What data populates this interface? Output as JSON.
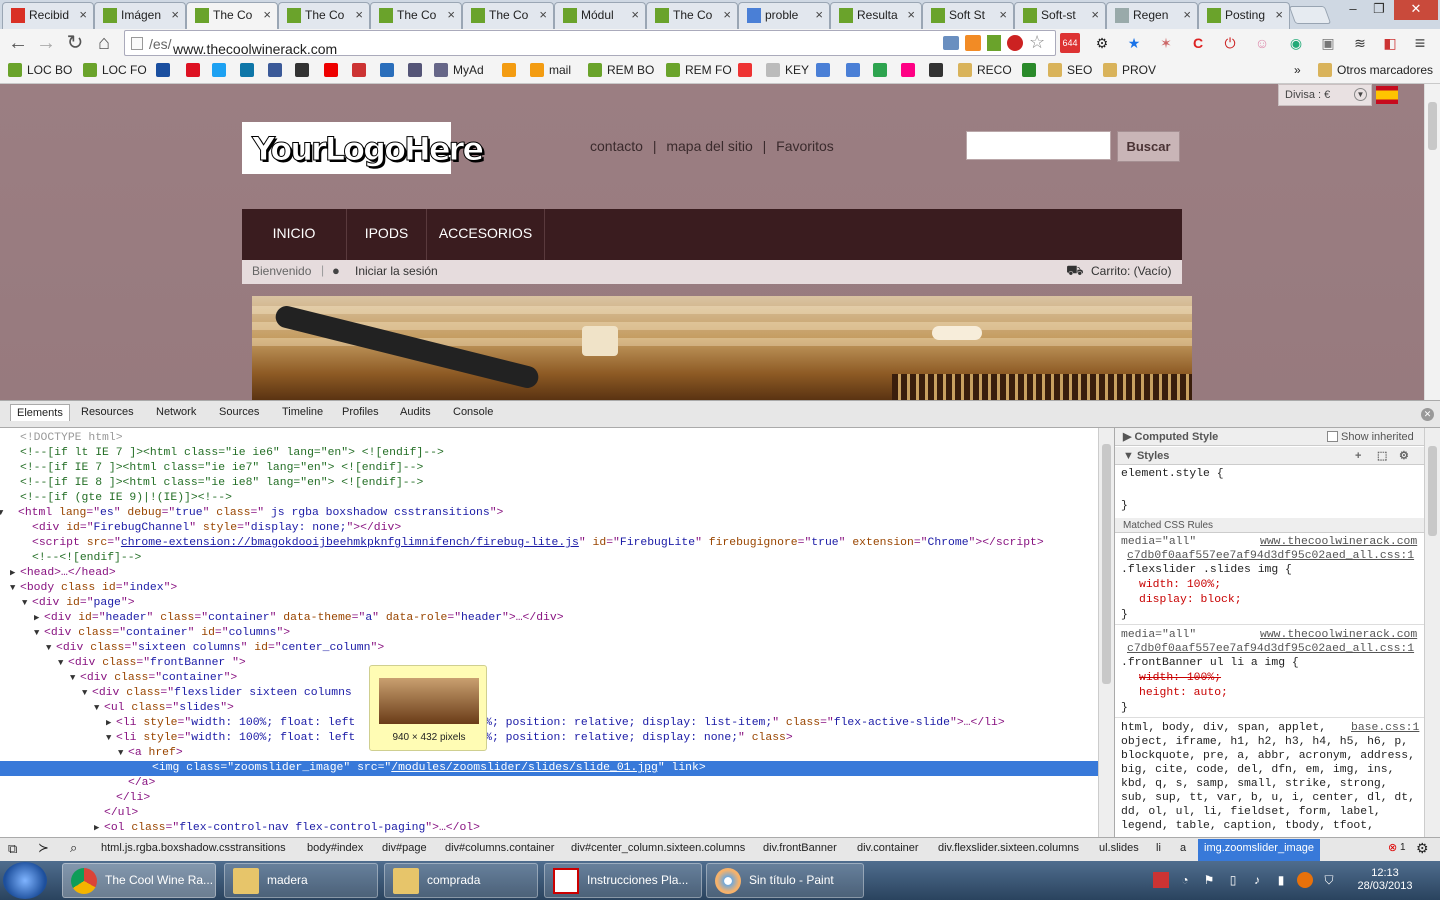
{
  "browser": {
    "tabs": [
      {
        "label": "Recibid",
        "icon": "gmail-icon",
        "color": "#d93025"
      },
      {
        "label": "Imágen",
        "icon": "prestashop-icon",
        "color": "#6aa32b"
      },
      {
        "label": "The Co",
        "icon": "prestashop-icon",
        "color": "#6aa32b"
      },
      {
        "label": "The Co",
        "icon": "prestashop-icon",
        "color": "#6aa32b"
      },
      {
        "label": "The Co",
        "icon": "prestashop-icon",
        "color": "#6aa32b"
      },
      {
        "label": "The Co",
        "icon": "prestashop-icon",
        "color": "#6aa32b"
      },
      {
        "label": "Módul",
        "icon": "prestashop-icon",
        "color": "#6aa32b"
      },
      {
        "label": "The Co",
        "icon": "prestashop-icon",
        "color": "#6aa32b"
      },
      {
        "label": "proble",
        "icon": "google-icon",
        "color": "#4a7fd6"
      },
      {
        "label": "Resulta",
        "icon": "prestashop-icon",
        "color": "#6aa32b"
      },
      {
        "label": "Soft St",
        "icon": "prestashop-icon",
        "color": "#6aa32b"
      },
      {
        "label": "Soft-st",
        "icon": "prestashop-icon",
        "color": "#6aa32b"
      },
      {
        "label": "Regen",
        "icon": "page-icon",
        "color": "#9aa"
      },
      {
        "label": "Posting",
        "icon": "prestashop-icon",
        "color": "#6aa32b"
      }
    ],
    "active_tab": 2,
    "close_glyph": "×",
    "window_controls": [
      "–",
      "❐",
      "✕"
    ],
    "url_host": "www.thecoolwinerack.com",
    "url_path": "/es/",
    "badge": "644",
    "bookmarks": [
      {
        "label": "LOC BO",
        "color": "#6aa32b"
      },
      {
        "label": "LOC FO",
        "color": "#6aa32b"
      },
      {
        "label": "",
        "color": "#1a4fa0"
      },
      {
        "label": "",
        "color": "#d12"
      },
      {
        "label": "",
        "color": "#1da1f2"
      },
      {
        "label": "",
        "color": "#0e76a8"
      },
      {
        "label": "",
        "color": "#3b5998"
      },
      {
        "label": "",
        "color": "#333"
      },
      {
        "label": "",
        "color": "#e00"
      },
      {
        "label": "",
        "color": "#c33"
      },
      {
        "label": "",
        "color": "#2a6ebb"
      },
      {
        "label": "",
        "color": "#557"
      },
      {
        "label": "MyAd",
        "color": "#668"
      },
      {
        "label": "",
        "color": "#f39c12"
      },
      {
        "label": "mail",
        "color": "#f39c12"
      },
      {
        "label": "REM BO",
        "color": "#6aa32b"
      },
      {
        "label": "REM FO",
        "color": "#6aa32b"
      },
      {
        "label": "",
        "color": "#e33"
      },
      {
        "label": "KEY",
        "color": "#bbb"
      },
      {
        "label": "",
        "color": "#4a7fd6"
      },
      {
        "label": "",
        "color": "#4a7fd6"
      },
      {
        "label": "",
        "color": "#2ea44f"
      },
      {
        "label": "",
        "color": "#ff0084"
      },
      {
        "label": "",
        "color": "#333"
      },
      {
        "label": "RECO",
        "color": "#d9b35b"
      },
      {
        "label": "",
        "color": "#2a8a2a"
      },
      {
        "label": "SEO",
        "color": "#d9b35b"
      },
      {
        "label": "PROV",
        "color": "#d9b35b"
      }
    ],
    "more_bookmarks": "»",
    "otros_marcadores": "Otros marcadores"
  },
  "site": {
    "divisa": "Divisa : €",
    "logo_text": "YourLogoHere",
    "toplinks": [
      "contacto",
      "mapa del sitio",
      "Favoritos"
    ],
    "separator": "|",
    "search_button": "Buscar",
    "menu": [
      "INICIO",
      "IPODS",
      "ACCESORIOS"
    ],
    "welcome": "Bienvenido",
    "login": "Iniciar la sesión",
    "cart": "Carrito: (Vacío)"
  },
  "devtools": {
    "tabs": [
      "Elements",
      "Resources",
      "Network",
      "Sources",
      "Timeline",
      "Profiles",
      "Audits",
      "Console"
    ],
    "dom_lines": [
      {
        "indent": 1,
        "tri": "",
        "html": "<span style='color:#999'>&lt;!DOCTYPE html&gt;</span>"
      },
      {
        "indent": 1,
        "tri": "",
        "html": "<span class='cm'>&lt;!--[if lt IE 7 ]&gt;&lt;html class=\"ie ie6\" lang=\"en\"&gt; &lt;![endif]--&gt;</span>"
      },
      {
        "indent": 1,
        "tri": "",
        "html": "<span class='cm'>&lt;!--[if IE 7 ]&gt;&lt;html class=\"ie ie7\" lang=\"en\"&gt; &lt;![endif]--&gt;</span>"
      },
      {
        "indent": 1,
        "tri": "",
        "html": "<span class='cm'>&lt;!--[if IE 8 ]&gt;&lt;html class=\"ie ie8\" lang=\"en\"&gt; &lt;![endif]--&gt;</span>"
      },
      {
        "indent": 1,
        "tri": "",
        "html": "<span class='cm'>&lt;!--[if (gte IE 9)|!(IE)]&gt;&lt;!--&gt;</span>"
      },
      {
        "indent": 0,
        "tri": "▼",
        "html": "&lt;html <span class='an'>lang</span>=\"<span class='av'>es</span>\" <span class='an'>debug</span>=\"<span class='av'>true</span>\" <span class='an'>class</span>=\"<span class='av'> js rgba boxshadow csstransitions</span>\"&gt;"
      },
      {
        "indent": 2,
        "tri": "",
        "html": "&lt;div <span class='an'>id</span>=\"<span class='av'>FirebugChannel</span>\" <span class='an'>style</span>=\"<span class='av'>display: none;</span>\"&gt;&lt;/div&gt;"
      },
      {
        "indent": 2,
        "tri": "",
        "html": "&lt;script <span class='an'>src</span>=\"<span class='lk'>chrome-extension://bmagokdooijbeehmkpknfglimnifench/firebug-lite.js</span>\" <span class='an'>id</span>=\"<span class='av'>FirebugLite</span>\" <span class='an'>firebugignore</span>=\"<span class='av'>true</span>\" <span class='an'>extension</span>=\"<span class='av'>Chrome</span>\"&gt;&lt;/script&gt;"
      },
      {
        "indent": 2,
        "tri": "",
        "html": "<span class='cm'>&lt;!--&lt;![endif]--&gt;</span>"
      },
      {
        "indent": 1,
        "tri": "▶",
        "html": "&lt;head&gt;…&lt;/head&gt;"
      },
      {
        "indent": 1,
        "tri": "▼",
        "html": "&lt;body <span class='an'>class</span> <span class='an'>id</span>=\"<span class='av'>index</span>\"&gt;"
      },
      {
        "indent": 2,
        "tri": "▼",
        "html": "&lt;div <span class='an'>id</span>=\"<span class='av'>page</span>\"&gt;"
      },
      {
        "indent": 3,
        "tri": "▶",
        "html": "&lt;div <span class='an'>id</span>=\"<span class='av'>header</span>\" <span class='an'>class</span>=\"<span class='av'>container</span>\" <span class='an'>data-theme</span>=\"<span class='av'>a</span>\" <span class='an'>data-role</span>=\"<span class='av'>header</span>\"&gt;…&lt;/div&gt;"
      },
      {
        "indent": 3,
        "tri": "▼",
        "html": "&lt;div <span class='an'>class</span>=\"<span class='av'>container</span>\" <span class='an'>id</span>=\"<span class='av'>columns</span>\"&gt;"
      },
      {
        "indent": 4,
        "tri": "▼",
        "html": "&lt;div <span class='an'>class</span>=\"<span class='av'>sixteen columns</span>\" <span class='an'>id</span>=\"<span class='av'>center_column</span>\"&gt;"
      },
      {
        "indent": 5,
        "tri": "▼",
        "html": "&lt;div <span class='an'>class</span>=\"<span class='av'>frontBanner </span>\"&gt;"
      },
      {
        "indent": 6,
        "tri": "▼",
        "html": "&lt;div <span class='an'>class</span>=\"<span class='av'>container</span>\"&gt;"
      },
      {
        "indent": 7,
        "tri": "▼",
        "html": "&lt;div <span class='an'>class</span>=\"<span class='av'>flexslider sixteen columns</span>"
      },
      {
        "indent": 8,
        "tri": "▼",
        "html": "&lt;ul <span class='an'>class</span>=\"<span class='av'>slides</span>\"&gt;"
      },
      {
        "indent": 9,
        "tri": "▶",
        "html": "&lt;li <span class='an'>style</span>=\"<span class='av'>width: 100%; float: left                100%; position: relative; display: list-item;</span>\" <span class='an'>class</span>=\"<span class='av'>flex-active-slide</span>\"&gt;…&lt;/li&gt;"
      },
      {
        "indent": 9,
        "tri": "▼",
        "html": "&lt;li <span class='an'>style</span>=\"<span class='av'>width: 100%; float: left                100%; position: relative; display: none;</span>\" <span class='an'>class</span>&gt;"
      },
      {
        "indent": 10,
        "tri": "▼",
        "html": "&lt;a <span class='an'>href</span>&gt;"
      },
      {
        "indent": 12,
        "tri": "",
        "html": "&lt;img class=\"zoomslider_image\" src=\"<u>/modules/zoomslider/slides/slide_01.jpg</u>\" link&gt;",
        "sel": true
      },
      {
        "indent": 10,
        "tri": "",
        "html": "&lt;/a&gt;"
      },
      {
        "indent": 9,
        "tri": "",
        "html": "&lt;/li&gt;"
      },
      {
        "indent": 8,
        "tri": "",
        "html": "&lt;/ul&gt;"
      },
      {
        "indent": 8,
        "tri": "▶",
        "html": "&lt;ol <span class='an'>class</span>=\"<span class='av'>flex-control-nav flex-control-paging</span>\"&gt;…&lt;/ol&gt;"
      }
    ],
    "tooltip_size": "940 × 432 pixels",
    "computed_style": "Computed Style",
    "show_inherited": "Show inherited",
    "styles": "Styles",
    "element_style": "element.style {",
    "close_brace": "}",
    "matched_rules": "Matched CSS Rules",
    "media_all": "media=\"all\"",
    "source_host": "www.thecoolwinerack.com",
    "source_file": "c7db0f0aaf557ee7af94d3df95c02aed_all.css:1",
    "rule1_selector": ".flexslider .slides img {",
    "rule1_props": [
      "width: 100%;",
      "display: block;"
    ],
    "rule2_selector": ".frontBanner ul li a img {",
    "rule2_props": [
      "width: 100%;",
      "height: auto;"
    ],
    "base_source": "base.css:1",
    "base_lines": [
      "html, body, div, span, applet,",
      "object, iframe, h1, h2, h3, h4, h5, h6, p,",
      "blockquote, pre, a, abbr, acronym, address,",
      "big, cite, code, del, dfn, em, img, ins,",
      "kbd, q, s, samp, small, strike, strong,",
      "sub, sup, tt, var, b, u, i, center, dl, dt,",
      "dd, ol, ul, li, fieldset, form, label,",
      "legend, table, caption, tbody, tfoot,"
    ],
    "breadcrumbs": [
      "html.js.rgba.boxshadow.csstransitions",
      "body#index",
      "div#page",
      "div#columns.container",
      "div#center_column.sixteen.columns",
      "div.frontBanner",
      "div.container",
      "div.flexslider.sixteen.columns",
      "ul.slides",
      "li",
      "a",
      "img.zoomslider_image"
    ],
    "error_count": "1"
  },
  "taskbar": {
    "tasks": [
      "The Cool Wine Ra...",
      "madera",
      "comprada",
      "Instrucciones Pla...",
      "Sin título - Paint"
    ],
    "time": "12:13",
    "date": "28/03/2013"
  }
}
